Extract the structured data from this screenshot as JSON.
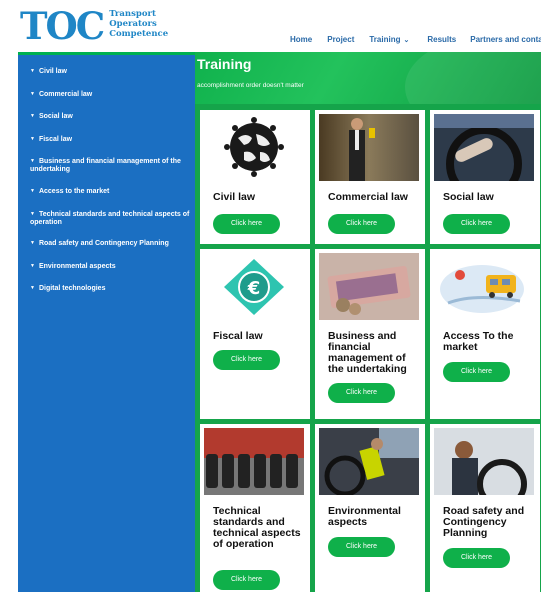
{
  "logo": {
    "mark": "TOC",
    "lines": [
      "Transport",
      "Operators",
      "Competence"
    ]
  },
  "nav": {
    "home": "Home",
    "project": "Project",
    "training": "Training",
    "results": "Results",
    "partners": "Partners and contacts"
  },
  "sidebar": {
    "items": [
      "Civil law",
      "Commercial law",
      "Social law",
      "Fiscal law",
      "Business and financial management of the undertaking",
      "Access to the market",
      "Technical standards and technical aspects of operation",
      "Road safety and Contingency Planning",
      "Environmental aspects",
      "Digital technologies"
    ]
  },
  "main": {
    "title": "Training",
    "subtitle": "accomplishment order doesn't matter",
    "cards": [
      {
        "title": "Civil law",
        "button": "Click here"
      },
      {
        "title": "Commercial law",
        "button": "Click here"
      },
      {
        "title": "Social law",
        "button": "Click here"
      },
      {
        "title": "Fiscal law",
        "button": "Click here"
      },
      {
        "title": "Business and financial management of the undertaking",
        "button": "Click here"
      },
      {
        "title": "Access To the market",
        "button": "Click here"
      },
      {
        "title": "Technical standards and technical aspects of operation",
        "button": "Click here"
      },
      {
        "title": "Environmental aspects",
        "button": "Click here"
      },
      {
        "title": "Road safety and Contingency Planning",
        "button": "Click here"
      }
    ]
  },
  "colors": {
    "brand_blue": "#1f86c6",
    "sidebar_blue": "#1b6fc2",
    "accent_green": "#0fb04a"
  }
}
